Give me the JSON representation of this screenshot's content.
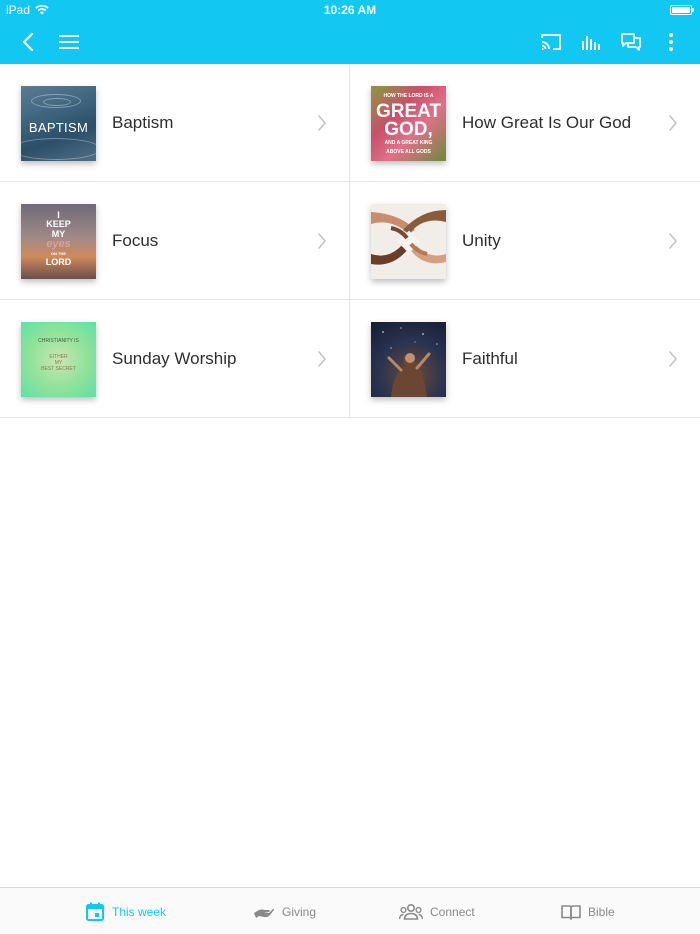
{
  "status_bar": {
    "carrier": "iPad",
    "time": "10:26 AM"
  },
  "nav": {
    "back_icon": "chevron-left-icon",
    "menu_icon": "hamburger-menu-icon",
    "actions": [
      "cast-icon",
      "audio-bars-icon",
      "chat-icon",
      "more-vertical-icon"
    ]
  },
  "series": [
    {
      "title": "Baptism",
      "thumb_text": "BAPTISM"
    },
    {
      "title": "How Great Is Our God",
      "thumb_text": [
        "HOW THE LORD IS A",
        "GREAT",
        "GOD,",
        "AND A GREAT KING",
        "ABOVE ALL GODS"
      ]
    },
    {
      "title": "Focus",
      "thumb_text": [
        "I",
        "KEEP",
        "MY",
        "eyes",
        "ON THE",
        "LORD"
      ]
    },
    {
      "title": "Unity"
    },
    {
      "title": "Sunday Worship",
      "thumb_text": [
        "CHRISTIANITY IS",
        "EITHER",
        "MY",
        "BEST SECRET"
      ]
    },
    {
      "title": "Faithful"
    }
  ],
  "tabs": [
    {
      "label": "This week",
      "icon": "calendar-icon",
      "active": true
    },
    {
      "label": "Giving",
      "icon": "giving-hand-icon",
      "active": false
    },
    {
      "label": "Connect",
      "icon": "people-icon",
      "active": false
    },
    {
      "label": "Bible",
      "icon": "book-icon",
      "active": false
    }
  ],
  "colors": {
    "accent": "#12c8f3",
    "divider": "#e4e4e4",
    "tab_inactive": "#8a8a8a"
  }
}
